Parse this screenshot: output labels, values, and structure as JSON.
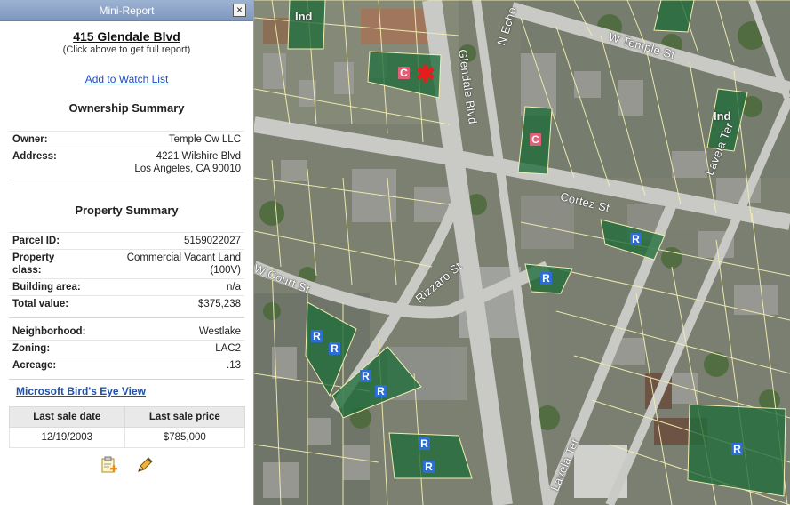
{
  "panel": {
    "title": "Mini-Report",
    "close_label": "×",
    "address": "415 Glendale Blvd",
    "hint": "(Click above to get full report)",
    "watch_link": "Add to Watch List",
    "ownership": {
      "title": "Ownership Summary",
      "owner_label": "Owner:",
      "owner_value": "Temple Cw LLC",
      "address_label": "Address:",
      "address_line1": "4221 Wilshire Blvd",
      "address_line2": "Los Angeles, CA 90010"
    },
    "property": {
      "title": "Property Summary",
      "rows": [
        {
          "label": "Parcel ID:",
          "value": "5159022027"
        },
        {
          "label": "Property class:",
          "value": "Commercial Vacant Land (100V)"
        },
        {
          "label": "Building area:",
          "value": "n/a"
        },
        {
          "label": "Total value:",
          "value": "$375,238"
        }
      ],
      "rows2": [
        {
          "label": "Neighborhood:",
          "value": "Westlake"
        },
        {
          "label": "Zoning:",
          "value": "LAC2"
        },
        {
          "label": "Acreage:",
          "value": ".13"
        }
      ]
    },
    "bird_link": "Microsoft Bird's Eye View",
    "sales": {
      "headers": [
        "Last sale date",
        "Last sale price"
      ],
      "rows": [
        [
          "12/19/2003",
          "$785,000"
        ]
      ]
    },
    "tools": [
      "add-note-icon",
      "edit-pencil-icon"
    ]
  },
  "map": {
    "streets": [
      "W Temple St",
      "Glendale Blvd",
      "N Echo",
      "Cortez St",
      "Lavela Ter",
      "Lavela Ter",
      "W Court St",
      "Rizzaro St"
    ],
    "zone_labels": [
      "Ind",
      "Ind",
      "C",
      "C",
      "R",
      "R",
      "R",
      "R",
      "R",
      "R",
      "R",
      "R",
      "R",
      "R",
      "R"
    ],
    "colors": {
      "zone_fill": "#1f6b3a",
      "zone_R_badge": "#2b6fd6",
      "zone_C_badge": "#e0607a",
      "marker": "#e81c1c"
    }
  }
}
